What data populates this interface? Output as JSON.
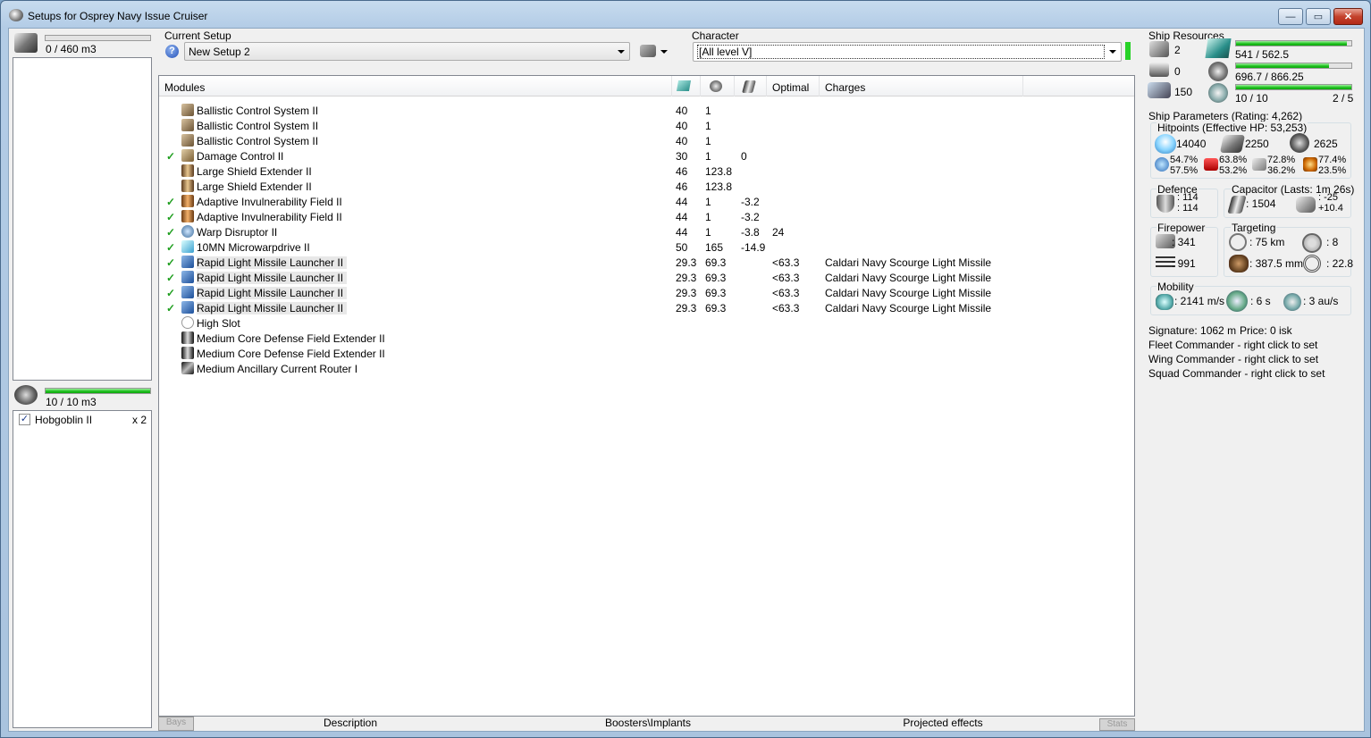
{
  "window": {
    "title": "Setups for Osprey Navy Issue Cruiser",
    "btn_min": "—",
    "btn_max": "▭",
    "btn_close": "✕"
  },
  "cargo": {
    "value": "0 / 460 m3",
    "fill": 0.0
  },
  "drones": {
    "value": "10 / 10 m3",
    "fill": 1.0,
    "items": [
      {
        "checked": true,
        "name": "Hobgoblin II",
        "qty": "x 2"
      }
    ]
  },
  "setup": {
    "label": "Current Setup",
    "value": "New Setup 2"
  },
  "character": {
    "label": "Character",
    "value": "[All level V]"
  },
  "grid": {
    "headers": {
      "modules": "Modules",
      "optimal": "Optimal",
      "charges": "Charges"
    },
    "rows": [
      {
        "checked": false,
        "icon": "ballistic-icon",
        "name": "Ballistic Control System II",
        "cpu": "40",
        "pg": "1",
        "cap": "",
        "opt": "",
        "charge": ""
      },
      {
        "checked": false,
        "icon": "ballistic-icon",
        "name": "Ballistic Control System II",
        "cpu": "40",
        "pg": "1",
        "cap": "",
        "opt": "",
        "charge": ""
      },
      {
        "checked": false,
        "icon": "ballistic-icon",
        "name": "Ballistic Control System II",
        "cpu": "40",
        "pg": "1",
        "cap": "",
        "opt": "",
        "charge": ""
      },
      {
        "checked": true,
        "icon": "damage-control-icon",
        "name": "Damage Control II",
        "cpu": "30",
        "pg": "1",
        "cap": "0",
        "opt": "",
        "charge": ""
      },
      {
        "checked": false,
        "icon": "shield-extender-icon",
        "name": "Large Shield Extender II",
        "cpu": "46",
        "pg": "123.8",
        "cap": "",
        "opt": "",
        "charge": ""
      },
      {
        "checked": false,
        "icon": "shield-extender-icon",
        "name": "Large Shield Extender II",
        "cpu": "46",
        "pg": "123.8",
        "cap": "",
        "opt": "",
        "charge": ""
      },
      {
        "checked": true,
        "icon": "invuln-field-icon",
        "name": "Adaptive Invulnerability Field II",
        "cpu": "44",
        "pg": "1",
        "cap": "-3.2",
        "opt": "",
        "charge": ""
      },
      {
        "checked": true,
        "icon": "invuln-field-icon",
        "name": "Adaptive Invulnerability Field II",
        "cpu": "44",
        "pg": "1",
        "cap": "-3.2",
        "opt": "",
        "charge": ""
      },
      {
        "checked": true,
        "icon": "warp-disruptor-icon",
        "name": "Warp Disruptor II",
        "cpu": "44",
        "pg": "1",
        "cap": "-3.8",
        "opt": "24",
        "charge": ""
      },
      {
        "checked": true,
        "icon": "microwarpdrive-icon",
        "name": "10MN Microwarpdrive II",
        "cpu": "50",
        "pg": "165",
        "cap": "-14.9",
        "opt": "",
        "charge": ""
      },
      {
        "checked": true,
        "icon": "missile-launcher-icon",
        "name": "Rapid Light Missile Launcher II",
        "cpu": "29.3",
        "pg": "69.3",
        "cap": "",
        "opt": "<63.3",
        "charge": "Caldari Navy Scourge Light Missile"
      },
      {
        "checked": true,
        "icon": "missile-launcher-icon",
        "name": "Rapid Light Missile Launcher II",
        "cpu": "29.3",
        "pg": "69.3",
        "cap": "",
        "opt": "<63.3",
        "charge": "Caldari Navy Scourge Light Missile"
      },
      {
        "checked": true,
        "icon": "missile-launcher-icon",
        "name": "Rapid Light Missile Launcher II",
        "cpu": "29.3",
        "pg": "69.3",
        "cap": "",
        "opt": "<63.3",
        "charge": "Caldari Navy Scourge Light Missile"
      },
      {
        "checked": true,
        "icon": "missile-launcher-icon",
        "name": "Rapid Light Missile Launcher II",
        "cpu": "29.3",
        "pg": "69.3",
        "cap": "",
        "opt": "<63.3",
        "charge": "Caldari Navy Scourge Light Missile"
      },
      {
        "checked": false,
        "icon": "high-slot-icon",
        "name": "High Slot",
        "cpu": "",
        "pg": "",
        "cap": "",
        "opt": "",
        "charge": ""
      },
      {
        "checked": false,
        "icon": "rig-icon",
        "name": "Medium Core Defense Field Extender II",
        "cpu": "",
        "pg": "",
        "cap": "",
        "opt": "",
        "charge": ""
      },
      {
        "checked": false,
        "icon": "rig-icon",
        "name": "Medium Core Defense Field Extender II",
        "cpu": "",
        "pg": "",
        "cap": "",
        "opt": "",
        "charge": ""
      },
      {
        "checked": false,
        "icon": "rig-router-icon",
        "name": "Medium Ancillary Current Router I",
        "cpu": "",
        "pg": "",
        "cap": "",
        "opt": "",
        "charge": ""
      }
    ]
  },
  "tabs": {
    "bays": "Bays",
    "description": "Description",
    "boosters": "Boosters\\Implants",
    "projected": "Projected effects",
    "stats": "Stats"
  },
  "resources": {
    "title": "Ship Resources",
    "turrets": "2",
    "launchers": "0",
    "calibration": "150",
    "cpu": "541 / 562.5",
    "cpu_fill": 0.962,
    "powergrid": "696.7 / 866.25",
    "powergrid_fill": 0.804,
    "drone_bw": "10 / 10",
    "drone_bw_fill": 1.0,
    "drones_active": "2 / 5"
  },
  "params": {
    "title": "Ship Parameters (Rating: 4,262)",
    "hp_title": "Hitpoints (Effective HP: 53,253)",
    "shield": "14040",
    "armor": "2250",
    "structure": "2625",
    "em": [
      "54.7%",
      "57.5%"
    ],
    "thermal": [
      "63.8%",
      "53.2%"
    ],
    "kinetic": [
      "72.8%",
      "36.2%"
    ],
    "explosive": [
      "77.4%",
      "23.5%"
    ],
    "defence_title": "Defence",
    "defence": [
      ": 114",
      ": 114"
    ],
    "cap_title": "Capacitor (Lasts: 1m 26s)",
    "cap_amount": ": 1504",
    "cap_delta": [
      ": -25",
      "+10.4"
    ],
    "firepower_title": "Firepower",
    "dps": ": 341",
    "volley": ": 991",
    "targeting_title": "Targeting",
    "range": ": 75 km",
    "max_targets": ": 8",
    "scan_res": ": 387.5 mm",
    "sensor": ": 22.8",
    "mobility_title": "Mobility",
    "speed": ": 2141 m/s",
    "align": ": 6 s",
    "warp": ": 3 au/s",
    "signature": "Signature: 1062 m",
    "price": "Price: 0 isk",
    "fleet": "Fleet Commander - right click to set",
    "wing": "Wing Commander - right click to set",
    "squad": "Squad Commander - right click to set"
  },
  "colors": {
    "bar_green": "#1bbf1b",
    "check_green": "#1e9e1e",
    "title_bar": "#b3cce6"
  }
}
